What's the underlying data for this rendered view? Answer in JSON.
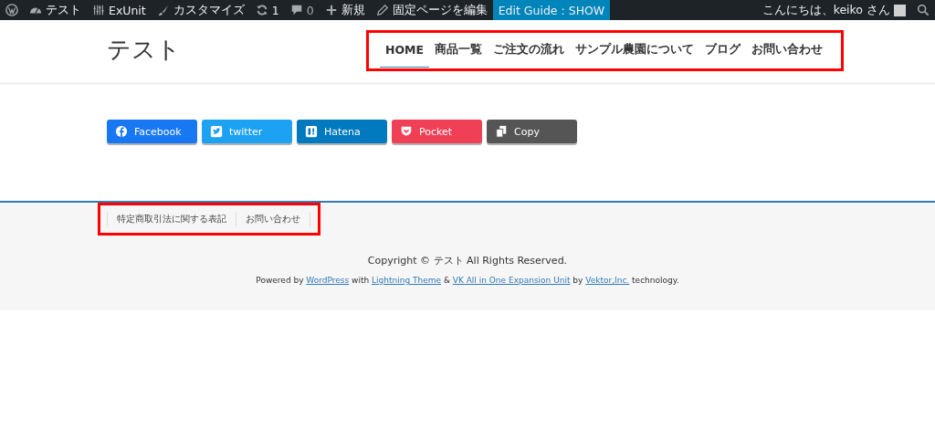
{
  "admin_bar": {
    "items": [
      {
        "kind": "wp-logo"
      },
      {
        "kind": "site",
        "label": "テスト"
      },
      {
        "kind": "exunit",
        "label": "ExUnit"
      },
      {
        "kind": "customize",
        "label": "カスタマイズ"
      },
      {
        "kind": "updates",
        "label": "1"
      },
      {
        "kind": "comments",
        "label": "0"
      },
      {
        "kind": "new",
        "label": "新規"
      },
      {
        "kind": "edit",
        "label": "固定ページを編集"
      },
      {
        "kind": "guide",
        "label": "Edit Guide : SHOW",
        "selected": true
      }
    ],
    "greeting": "こんにちは、keiko さん"
  },
  "header": {
    "site_title": "テスト",
    "nav": {
      "highlighted": true,
      "items": [
        {
          "label": "HOME",
          "selected": true
        },
        {
          "label": "商品一覧",
          "selected": false
        },
        {
          "label": "ご注文の流れ",
          "selected": false
        },
        {
          "label": "サンプル農園について",
          "selected": false
        },
        {
          "label": "ブログ",
          "selected": false
        },
        {
          "label": "お問い合わせ",
          "selected": false
        }
      ]
    }
  },
  "share_buttons": [
    {
      "kind": "facebook",
      "label": "Facebook",
      "color": "#1877f2"
    },
    {
      "kind": "twitter",
      "label": "twitter",
      "color": "#1da1f2"
    },
    {
      "kind": "hatena",
      "label": "Hatena",
      "color": "#0079be"
    },
    {
      "kind": "pocket",
      "label": "Pocket",
      "color": "#ef4056"
    },
    {
      "kind": "copy",
      "label": "Copy",
      "color": "#555555"
    }
  ],
  "footer": {
    "nav": {
      "highlighted": true,
      "items": [
        "特定商取引法に関する表記",
        "お問い合わせ"
      ]
    },
    "copyright": "Copyright © テスト All Rights Reserved.",
    "powered": [
      {
        "kind": "text",
        "text": "Powered by "
      },
      {
        "kind": "link",
        "text": "WordPress"
      },
      {
        "kind": "text",
        "text": " with "
      },
      {
        "kind": "link",
        "text": "Lightning Theme"
      },
      {
        "kind": "text",
        "text": " & "
      },
      {
        "kind": "link",
        "text": "VK All in One Expansion Unit"
      },
      {
        "kind": "text",
        "text": " by "
      },
      {
        "kind": "link",
        "text": "Vektor,Inc."
      },
      {
        "kind": "text",
        "text": " technology."
      }
    ]
  }
}
